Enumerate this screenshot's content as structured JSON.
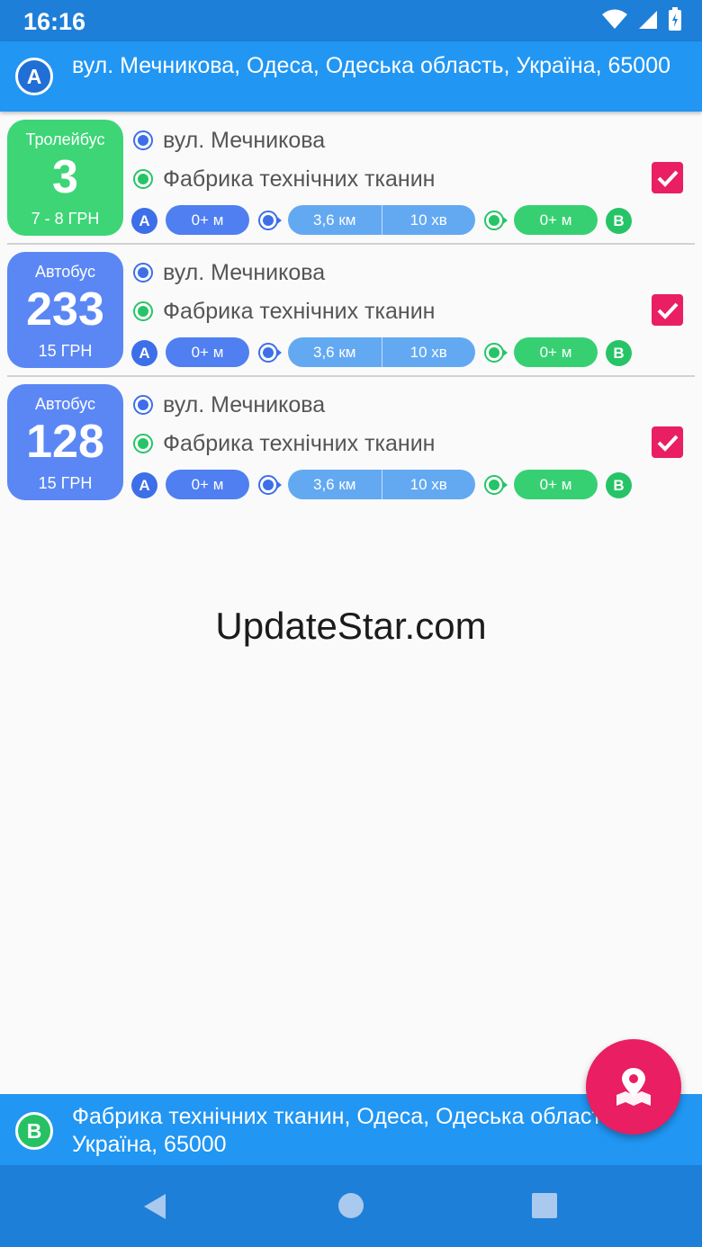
{
  "status_bar": {
    "time": "16:16"
  },
  "origin": {
    "marker": "A",
    "address": "вул. Мечникова, Одеса, Одеська область, Україна, 65000"
  },
  "destination": {
    "marker": "B",
    "address_line1": "Фабрика технічних тканин, Одеса, Одеська область,",
    "address_line2": "Україна, 65000"
  },
  "routes": [
    {
      "type": "Тролейбус",
      "number": "3",
      "price": "7 - 8 ГРН",
      "from_stop": "вул. Мечникова",
      "to_stop": "Фабрика технічних тканин",
      "walk_start": "0+ м",
      "distance": "3,6 км",
      "duration": "10 хв",
      "walk_end": "0+ м",
      "checked": true
    },
    {
      "type": "Автобус",
      "number": "233",
      "price": "15 ГРН",
      "from_stop": "вул. Мечникова",
      "to_stop": "Фабрика технічних тканин",
      "walk_start": "0+ м",
      "distance": "3,6 км",
      "duration": "10 хв",
      "walk_end": "0+ м",
      "checked": true
    },
    {
      "type": "Автобус",
      "number": "128",
      "price": "15 ГРН",
      "from_stop": "вул. Мечникова",
      "to_stop": "Фабрика технічних тканин",
      "walk_start": "0+ м",
      "distance": "3,6 км",
      "duration": "10 хв",
      "walk_end": "0+ м",
      "checked": true
    }
  ],
  "chip_letters": {
    "start": "A",
    "end": "B"
  },
  "watermark": "UpdateStar.com",
  "icons": {
    "fab": "map-pin-icon",
    "nav_back": "back-triangle-icon",
    "nav_home": "home-circle-icon",
    "nav_recents": "recents-square-icon"
  },
  "colors": {
    "primary": "#2196f3",
    "trolleybus": "#3ed577",
    "bus": "#5b87f5",
    "accent": "#e91e63"
  }
}
